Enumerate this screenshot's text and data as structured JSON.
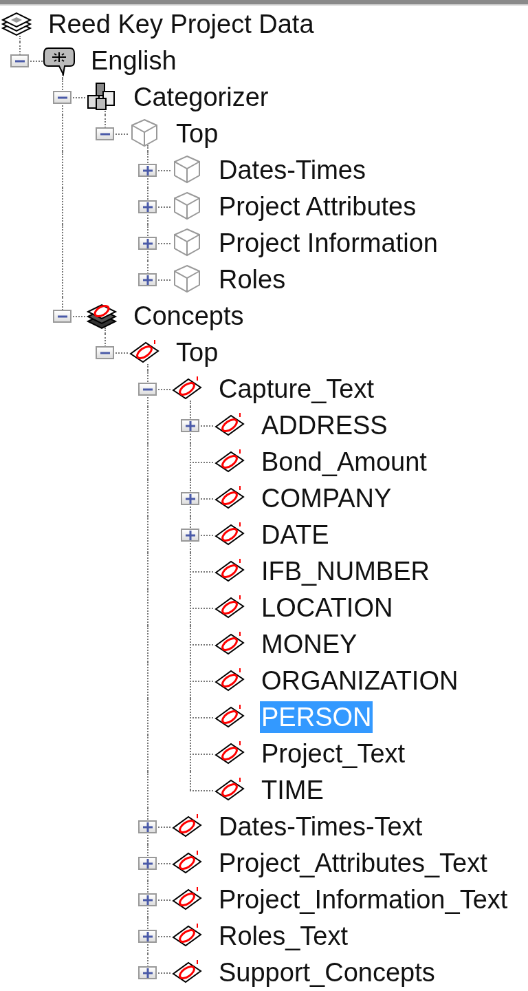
{
  "tree": [
    {
      "label": "Reed Key Project Data",
      "kind": "database",
      "selected": false,
      "children": [
        {
          "label": "English",
          "kind": "language",
          "selected": false,
          "expanded": true,
          "children": [
            {
              "label": "Categorizer",
              "kind": "categorizer",
              "selected": false,
              "expanded": true,
              "children": [
                {
                  "label": "Top",
                  "kind": "category",
                  "selected": false,
                  "expanded": true,
                  "children": [
                    {
                      "label": "Dates-Times",
                      "kind": "category",
                      "selected": false,
                      "expanded": false
                    },
                    {
                      "label": "Project Attributes",
                      "kind": "category",
                      "selected": false,
                      "expanded": false
                    },
                    {
                      "label": "Project Information",
                      "kind": "category",
                      "selected": false,
                      "expanded": false
                    },
                    {
                      "label": "Roles",
                      "kind": "category",
                      "selected": false,
                      "expanded": false
                    }
                  ]
                }
              ]
            },
            {
              "label": "Concepts",
              "kind": "concepts",
              "selected": false,
              "expanded": true,
              "children": [
                {
                  "label": "Top",
                  "kind": "concept",
                  "selected": false,
                  "expanded": true,
                  "children": [
                    {
                      "label": "Capture_Text",
                      "kind": "concept",
                      "selected": false,
                      "expanded": true,
                      "children": [
                        {
                          "label": "ADDRESS",
                          "kind": "concept",
                          "selected": false,
                          "expanded": false
                        },
                        {
                          "label": "Bond_Amount",
                          "kind": "concept",
                          "selected": false
                        },
                        {
                          "label": "COMPANY",
                          "kind": "concept",
                          "selected": false,
                          "expanded": false
                        },
                        {
                          "label": "DATE",
                          "kind": "concept",
                          "selected": false,
                          "expanded": false
                        },
                        {
                          "label": "IFB_NUMBER",
                          "kind": "concept",
                          "selected": false
                        },
                        {
                          "label": "LOCATION",
                          "kind": "concept",
                          "selected": false
                        },
                        {
                          "label": "MONEY",
                          "kind": "concept",
                          "selected": false
                        },
                        {
                          "label": "ORGANIZATION",
                          "kind": "concept",
                          "selected": false
                        },
                        {
                          "label": "PERSON",
                          "kind": "concept",
                          "selected": true
                        },
                        {
                          "label": "Project_Text",
                          "kind": "concept",
                          "selected": false
                        },
                        {
                          "label": "TIME",
                          "kind": "concept",
                          "selected": false
                        }
                      ]
                    },
                    {
                      "label": "Dates-Times-Text",
                      "kind": "concept",
                      "selected": false,
                      "expanded": false
                    },
                    {
                      "label": "Project_Attributes_Text",
                      "kind": "concept",
                      "selected": false,
                      "expanded": false
                    },
                    {
                      "label": "Project_Information_Text",
                      "kind": "concept",
                      "selected": false,
                      "expanded": false
                    },
                    {
                      "label": "Roles_Text",
                      "kind": "concept",
                      "selected": false,
                      "expanded": false
                    },
                    {
                      "label": "Support_Concepts",
                      "kind": "concept",
                      "selected": false,
                      "expanded": false
                    }
                  ]
                }
              ]
            }
          ]
        }
      ]
    }
  ]
}
